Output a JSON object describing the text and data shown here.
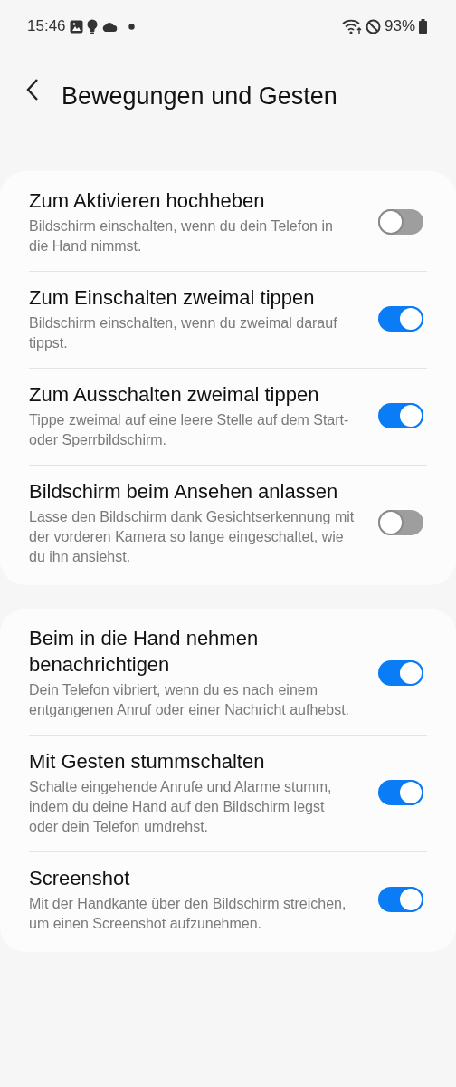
{
  "status_bar": {
    "time": "15:46",
    "battery": "93%"
  },
  "header": {
    "title": "Bewegungen und Gesten"
  },
  "groups": [
    {
      "items": [
        {
          "title": "Zum Aktivieren hochheben",
          "description": "Bildschirm einschalten, wenn du dein Telefon in die Hand nimmst.",
          "on": false
        },
        {
          "title": "Zum Einschalten zweimal tippen",
          "description": "Bildschirm einschalten, wenn du zweimal darauf tippst.",
          "on": true
        },
        {
          "title": "Zum Ausschalten zweimal tippen",
          "description": "Tippe zweimal auf eine leere Stelle auf dem Start- oder Sperrbildschirm.",
          "on": true
        },
        {
          "title": "Bildschirm beim Ansehen anlassen",
          "description": "Lasse den Bildschirm dank Gesichtserkennung mit der vorderen Kamera so lange eingeschaltet, wie du ihn ansiehst.",
          "on": false
        }
      ]
    },
    {
      "items": [
        {
          "title": "Beim in die Hand nehmen benachrichtigen",
          "description": "Dein Telefon vibriert, wenn du es nach einem entgangenen Anruf oder einer Nachricht aufhebst.",
          "on": true
        },
        {
          "title": "Mit Gesten stummschalten",
          "description": "Schalte eingehende Anrufe und Alarme stumm, indem du deine Hand auf den Bildschirm legst oder dein Telefon umdrehst.",
          "on": true
        },
        {
          "title": "Screenshot",
          "description": "Mit der Handkante über den Bildschirm streichen, um einen Screenshot aufzunehmen.",
          "on": true
        }
      ]
    }
  ]
}
